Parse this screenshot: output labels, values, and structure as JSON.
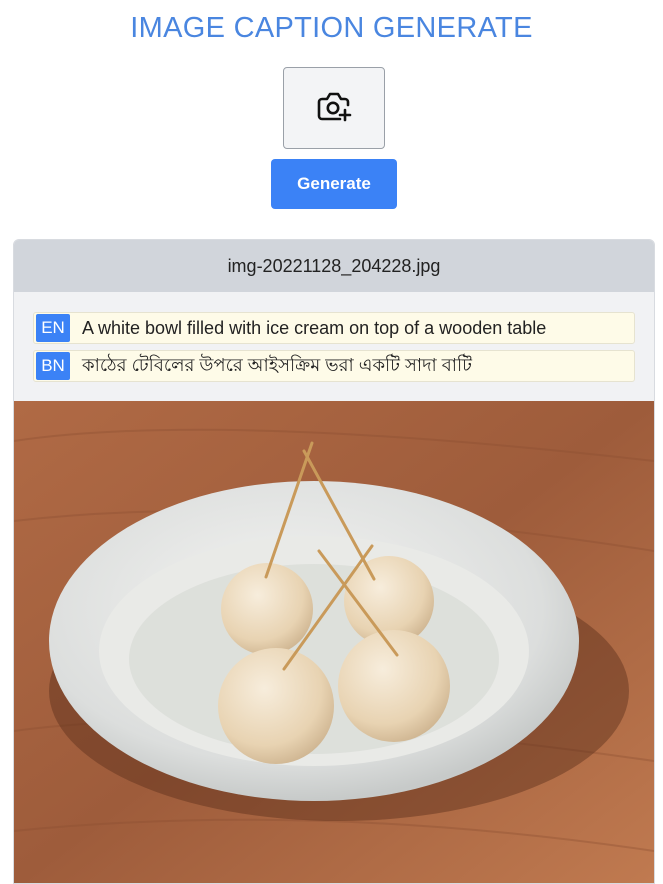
{
  "header": {
    "title": "IMAGE CAPTION GENERATE"
  },
  "upload": {
    "icon": "camera-plus-icon"
  },
  "actions": {
    "generate_label": "Generate"
  },
  "result": {
    "filename": "img-20221128_204228.jpg",
    "captions": [
      {
        "lang": "EN",
        "text": "A white bowl filled with ice cream on top of a wooden table"
      },
      {
        "lang": "BN",
        "text": "কাঠের টেবিলের উপরে আইসক্রিম ভরা একটি সাদা বাটি"
      }
    ]
  },
  "colors": {
    "accent": "#3b82f6",
    "title": "#4a86e0",
    "caption_bg": "#fefbe8"
  }
}
